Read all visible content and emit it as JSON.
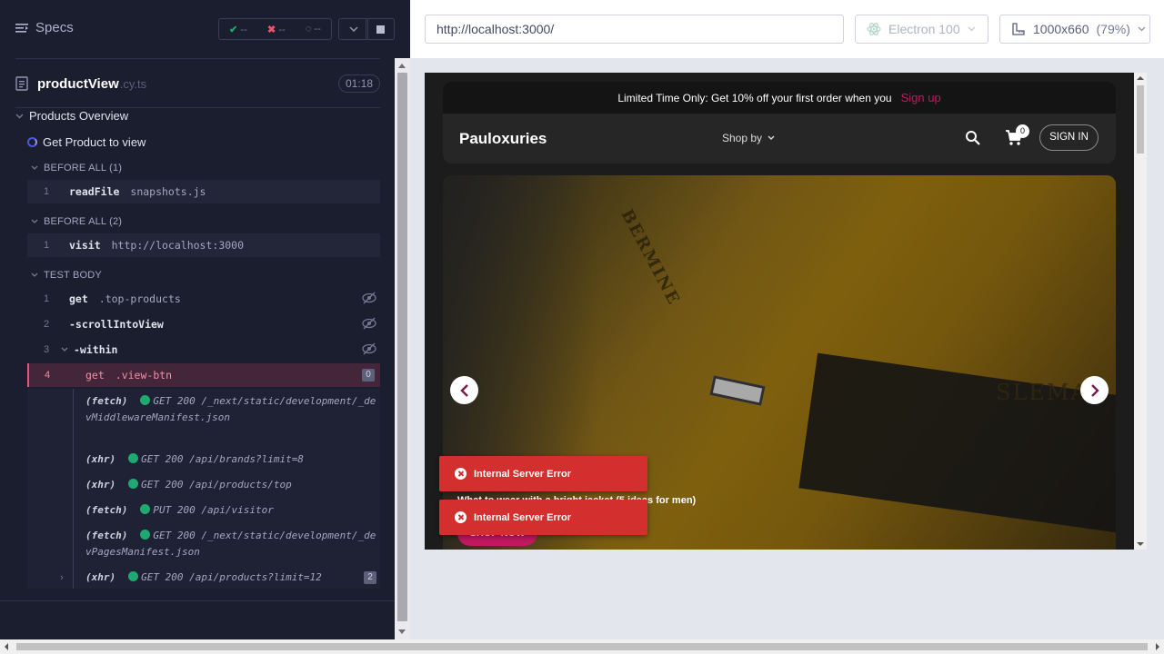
{
  "reporter": {
    "specs_label": "Specs",
    "stats": {
      "passed": "--",
      "failed": "--",
      "pending": "--"
    },
    "spec": {
      "name": "productView",
      "ext": ".cy.ts",
      "duration": "01:18"
    },
    "suite_title": "Products Overview",
    "test_title": "Get Product to view",
    "hooks": [
      {
        "title": "BEFORE ALL (1)",
        "commands": [
          {
            "num": "1",
            "name": "readFile",
            "message": "snapshots.js"
          }
        ]
      },
      {
        "title": "BEFORE ALL (2)",
        "commands": [
          {
            "num": "1",
            "name": "visit",
            "message": "http://localhost:3000"
          }
        ]
      },
      {
        "title": "TEST BODY",
        "commands": [
          {
            "num": "1",
            "name": "get",
            "message": ".top-products"
          },
          {
            "num": "2",
            "name": "-scrollIntoView",
            "message": ""
          },
          {
            "num": "3",
            "name": "-within",
            "message": ""
          },
          {
            "num": "4",
            "name": "get",
            "message": ".view-btn",
            "badge": "0"
          }
        ]
      }
    ],
    "logs": [
      {
        "kind": "(fetch)",
        "text": "GET 200 /_next/static/development/_devMiddlewareManifest.json"
      },
      {
        "kind": "(xhr)",
        "text": "GET 200 /api/brands?limit=8"
      },
      {
        "kind": "(xhr)",
        "text": "GET 200 /api/products/top"
      },
      {
        "kind": "(fetch)",
        "text": "PUT 200 /api/visitor"
      },
      {
        "kind": "(fetch)",
        "text": "GET 200 /_next/static/development/_devPagesManifest.json"
      },
      {
        "kind": "(xhr)",
        "text": "GET 200 /api/products?limit=12",
        "badge": "2"
      }
    ]
  },
  "aut": {
    "url": "http://localhost:3000/",
    "browser": "Electron 100",
    "viewport": "1000x660",
    "zoom": "(79%)"
  },
  "site": {
    "promo_text": "Limited Time Only: Get 10% off your first order when you",
    "promo_link": "Sign up",
    "brand": "Pauloxuries",
    "shop_by": "Shop by",
    "cart_count": "0",
    "signin": "SIGN IN",
    "hero_caption": "What to wear with a bright jacket (5 ideas for men)",
    "shop_now": "SHOP NOW",
    "hero_text_1": "BERMINE",
    "hero_text_2": "SLEMAN",
    "toasts": [
      "Internal Server Error",
      "Internal Server Error"
    ]
  },
  "colors": {
    "reporter_bg": "#1b1e2e",
    "active_cmd": "#44263a",
    "accent_pink": "#c21860",
    "toast_red": "#d32f2f",
    "success_green": "#1fa971"
  }
}
